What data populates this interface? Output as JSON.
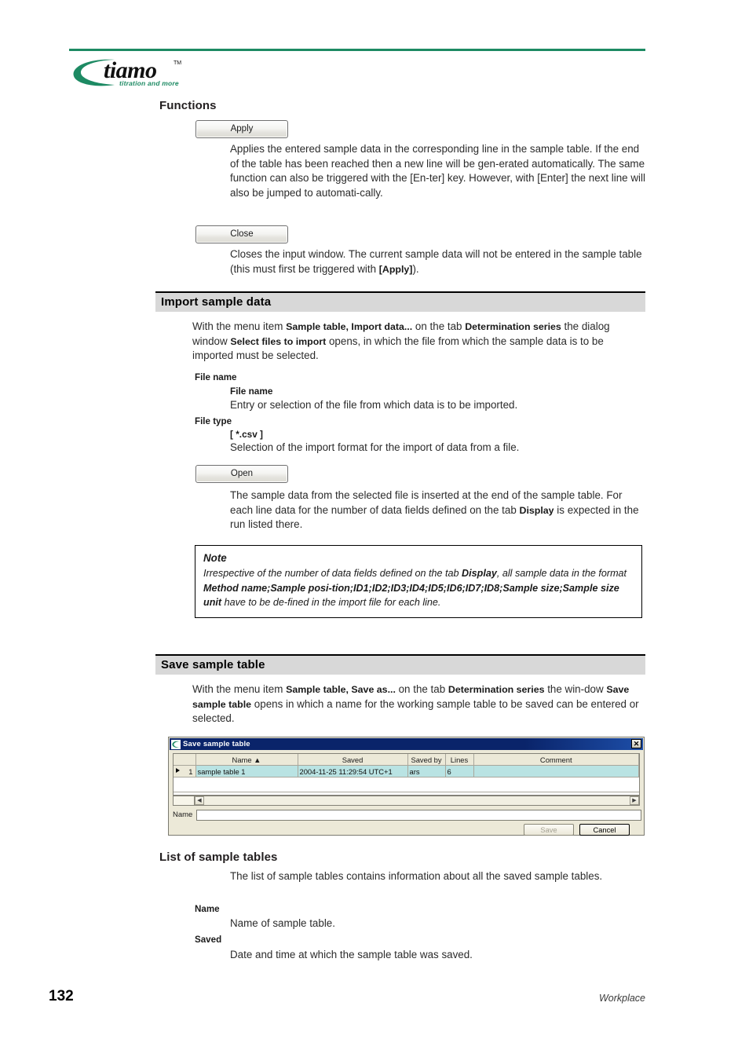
{
  "header": {
    "logo_word": "tiamo",
    "logo_tm": "TM",
    "logo_tagline": "titration and more",
    "rule_color": "#1d8a63"
  },
  "sections": {
    "functions": {
      "heading": "Functions",
      "apply_button": "Apply",
      "apply_text_1": "Applies the entered sample data in the corresponding line in the sample table. If the end of the table has been reached then a new line will be gen-erated automatically. The same function can also be triggered with the [En-ter] key. However, with [Enter] the next line will also be jumped to automati-cally.",
      "close_button": "Close",
      "close_text_pre": "Closes the input window. The current sample data will not be entered in the sample table (this must first be triggered with ",
      "close_text_bold": "[Apply]",
      "close_text_post": ")."
    },
    "import_sample_data": {
      "band_title": "Import sample data",
      "intro_1": "With the menu item ",
      "intro_b1": "Sample table, Import data...",
      "intro_2": " on the tab ",
      "intro_b2": "Determination series",
      "intro_3": " the dialog window ",
      "intro_b3": "Select files to import",
      "intro_4": " opens, in which the file from which the sample data is to be imported must be selected.",
      "file_name_head": "File name",
      "file_name_sub": "File name",
      "file_name_desc": "Entry or selection of the file from which data is to be imported.",
      "file_type_head": "File type",
      "file_type_sub": "[ *.csv ]",
      "file_type_desc": "Selection of the import format for the import of data from a file.",
      "open_button": "Open",
      "open_text_1": "The sample data from the selected file is inserted at the end of the sample table. For each line data for the number of data fields defined on the tab ",
      "open_text_b": "Display",
      "open_text_2": " is expected in the run listed there."
    },
    "note": {
      "title": "Note",
      "t1": "Irrespective of the number of data fields defined on the tab ",
      "b1": "Display",
      "t2": ", all sample data in the format ",
      "b2": "Method name;Sample posi-",
      "b3": "tion;ID1;ID2;ID3;ID4;ID5;ID6;ID7;ID8;Sample size;Sample size unit",
      "t3": " have to be de-fined in the import file for each line."
    },
    "save_sample_table": {
      "band_title": "Save sample table",
      "intro_1": "With the menu item ",
      "intro_b1": "Sample table, Save as...",
      "intro_2": " on the tab ",
      "intro_b2": "Determination series",
      "intro_3": " the win-dow ",
      "intro_b3": "Save sample table",
      "intro_4": " opens in which a name for the working sample table to be saved can be entered or selected."
    },
    "list_of_sample_tables": {
      "heading": "List of sample tables",
      "desc": "The list of sample tables contains information about all the saved sample tables.",
      "name_head": "Name",
      "name_desc": "Name of sample table.",
      "saved_head": "Saved",
      "saved_desc": "Date and time at which the sample table was saved."
    }
  },
  "dialog": {
    "title": "Save sample table",
    "close_glyph": "✕",
    "columns": [
      "",
      "Name  ▲",
      "Saved",
      "Saved by",
      "Lines",
      "Comment"
    ],
    "rows": [
      {
        "index": "1",
        "name": "sample table 1",
        "saved": "2004-11-25 11:29:54 UTC+1",
        "saved_by": "ars",
        "lines": "6",
        "comment": ""
      }
    ],
    "name_label": "Name",
    "name_value": "",
    "save_button": "Save",
    "cancel_button": "Cancel",
    "scroll_left_glyph": "◀",
    "scroll_right_glyph": "▶"
  },
  "footer": {
    "page_number": "132",
    "chapter": "Workplace"
  }
}
